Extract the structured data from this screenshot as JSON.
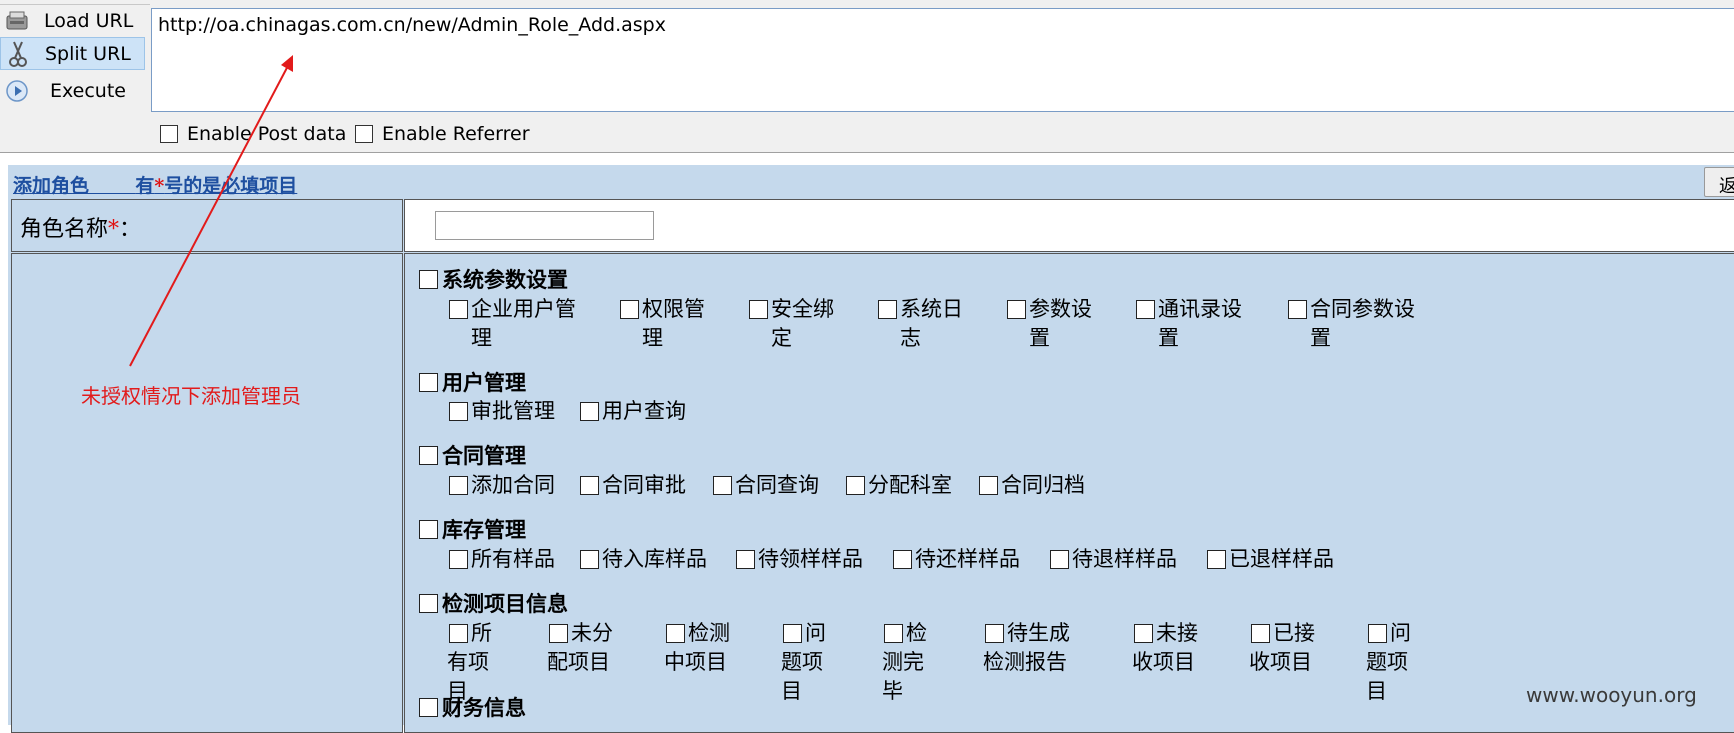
{
  "hackbar": {
    "commands": [
      {
        "label": "Load URL",
        "icon": "load-url-icon",
        "active": false
      },
      {
        "label": "Split URL",
        "icon": "scissors-icon",
        "active": true
      },
      {
        "label": "Execute",
        "icon": "play-icon",
        "active": false
      }
    ],
    "url": "http://oa.chinagas.com.cn/new/Admin_Role_Add.aspx",
    "enable_post": "Enable Post data",
    "enable_referrer": "Enable Referrer"
  },
  "form": {
    "title": "添加角色",
    "required_note_prefix": "有",
    "required_star": "*",
    "required_note_suffix": "号的是必填项目",
    "back_button": "返",
    "role_name_label": "角色名称",
    "role_name_colon": "：",
    "role_name_value": "",
    "groups": [
      {
        "label": "系统参数设置",
        "items": [
          "企业用户管理",
          "权限管理",
          "安全绑定",
          "系统日志",
          "参数设置",
          "通讯录设置",
          "合同参数设置"
        ]
      },
      {
        "label": "用户管理",
        "items": [
          "审批管理",
          "用户查询"
        ]
      },
      {
        "label": "合同管理",
        "items": [
          "添加合同",
          "合同审批",
          "合同查询",
          "分配科室",
          "合同归档"
        ]
      },
      {
        "label": "库存管理",
        "items": [
          "所有样品",
          "待入库样品",
          "待领样样品",
          "待还样样品",
          "待退样样品",
          "已退样样品"
        ]
      },
      {
        "label": "检测项目信息",
        "items": [
          "所有项目",
          "未分配项目",
          "检测中项目",
          "问题项目",
          "检测完毕",
          "待生成检测报告",
          "未接收项目",
          "已接收项目",
          "问题项目"
        ]
      },
      {
        "label": "财务信息",
        "items": []
      }
    ]
  },
  "annotation": {
    "text": "未授权情况下添加管理员",
    "color": "#e21b1b"
  },
  "watermark": "www.wooyun.org",
  "colors": {
    "form_background": "#c5d9ec",
    "title_link": "#1e4fa0",
    "required_star": "#e01010",
    "toolbar_background": "#f0f0f0"
  }
}
